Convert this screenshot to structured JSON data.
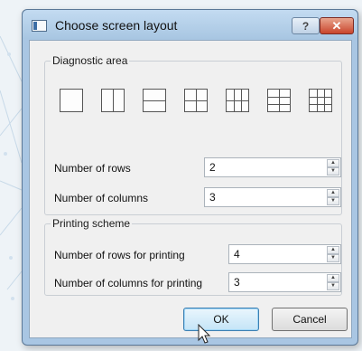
{
  "window": {
    "title": "Choose screen layout",
    "help_label": "?",
    "close_label": "✕"
  },
  "diagnostic_area": {
    "legend": "Diagnostic area",
    "layout_options": [
      {
        "name": "1x1",
        "rows": 1,
        "cols": 1
      },
      {
        "name": "1x2",
        "rows": 1,
        "cols": 2
      },
      {
        "name": "2x1",
        "rows": 2,
        "cols": 1
      },
      {
        "name": "2x2",
        "rows": 2,
        "cols": 2
      },
      {
        "name": "2x3",
        "rows": 2,
        "cols": 3
      },
      {
        "name": "3x2",
        "rows": 3,
        "cols": 2
      },
      {
        "name": "3x3",
        "rows": 3,
        "cols": 3
      }
    ],
    "rows_label": "Number of rows",
    "rows_value": "2",
    "columns_label": "Number of columns",
    "columns_value": "3"
  },
  "printing_scheme": {
    "legend": "Printing scheme",
    "rows_label": "Number of rows for printing",
    "rows_value": "4",
    "columns_label": "Number of columns for printing",
    "columns_value": "3"
  },
  "buttons": {
    "ok": "OK",
    "cancel": "Cancel"
  },
  "colors": {
    "window_frame": "#a9c6e3",
    "close_button": "#c9452c",
    "dialog_body": "#f0f0f0"
  }
}
